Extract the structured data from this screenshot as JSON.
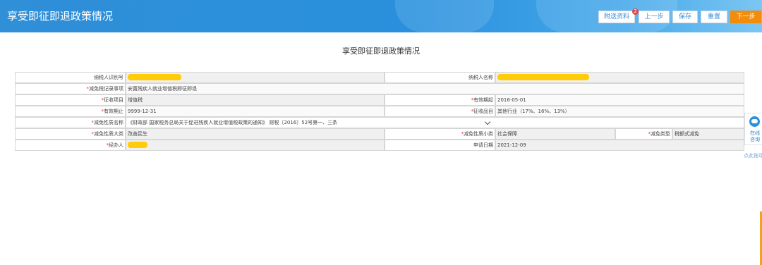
{
  "header": {
    "title": "享受即征即退政策情况"
  },
  "toolbar": {
    "attach_label": "附送资料",
    "attach_badge": "2",
    "prev_label": "上一步",
    "save_label": "保存",
    "reset_label": "重置",
    "next_label": "下一步"
  },
  "form": {
    "title": "享受即征即退政策情况",
    "rows": {
      "r1": {
        "taxpayer_id_label": "纳税人识别号",
        "taxpayer_name_label": "纳税人名称"
      },
      "r2": {
        "reduction_item_label": "减免税记录事项",
        "reduction_item_value": "安置残疾人就业增值税即征即退"
      },
      "r3": {
        "levy_item_label": "征收项目",
        "levy_item_value": "增值税",
        "valid_from_label": "有效期起",
        "valid_from_value": "2016-05-01"
      },
      "r4": {
        "valid_to_label": "有效期止",
        "valid_to_value": "9999-12-31",
        "levy_category_label": "征收品目",
        "levy_category_value": "其他行业（17%、16%、13%）"
      },
      "r5": {
        "reduction_name_label": "减免性质名称",
        "reduction_name_value": "《财政部 国家税务总局关于促进残疾人就业增值税政策的通知》 财税〔2016〕52号第一、三条"
      },
      "r6": {
        "category_label": "减免性质大类",
        "category_value": "改善民生",
        "subcategory_label": "减免性质小类",
        "subcategory_value": "社会保障",
        "type_label": "减免类型",
        "type_value": "税额式减免"
      },
      "r7": {
        "handler_label": "经办人",
        "apply_date_label": "申请日期",
        "apply_date_value": "2021-12-09"
      }
    },
    "required_mark": "*"
  },
  "side_widget": {
    "line1": "在线",
    "line2": "咨询",
    "link": "点此拖动"
  },
  "colors": {
    "header": "#2a90dd",
    "primary": "#f28c0a",
    "required": "#e23030",
    "redaction": "#ffcc0a"
  }
}
